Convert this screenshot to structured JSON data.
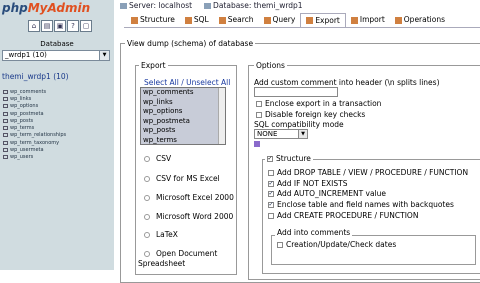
{
  "sidebar": {
    "logo_main": "php",
    "logo_accent": "MyAdmin",
    "icons": [
      "home-icon",
      "sql-icon",
      "query-icon",
      "docs-icon",
      "exit-icon"
    ],
    "db_label": "Database",
    "db_selected": "_wrdp1 (10)",
    "db_title": "themi_wrdp1 (10)",
    "tables": [
      "wp_comments",
      "wp_links",
      "wp_options",
      "wp_postmeta",
      "wp_posts",
      "wp_terms",
      "wp_term_relationships",
      "wp_term_taxonomy",
      "wp_usermeta",
      "wp_users"
    ]
  },
  "breadcrumb": {
    "server": "Server: localhost",
    "database": "Database: themi_wrdp1"
  },
  "tabs": [
    "Structure",
    "SQL",
    "Search",
    "Query",
    "Export",
    "Import",
    "Operations"
  ],
  "view_dump_title": "View dump (schema) of database",
  "export": {
    "legend": "Export",
    "select_all": "Select All / Unselect All",
    "tables": [
      "wp_comments",
      "wp_links",
      "wp_options",
      "wp_postmeta",
      "wp_posts",
      "wp_terms"
    ],
    "formats": [
      "CSV",
      "CSV for MS Excel",
      "Microsoft Excel 2000",
      "Microsoft Word 2000",
      "LaTeX",
      "Open Document",
      "Spreadsheet"
    ]
  },
  "options": {
    "legend": "Options",
    "comment_label": "Add custom comment into header (\\n splits lines)",
    "comment_value": "",
    "enclose_transaction": "Enclose export in a transaction",
    "disable_fk": "Disable foreign key checks",
    "compat_label": "SQL compatibility mode",
    "compat_value": "NONE",
    "structure": {
      "legend": "Structure",
      "drop_table": "Add DROP TABLE / VIEW / PROCEDURE / FUNCTION",
      "if_not_exists": "Add IF NOT EXISTS",
      "auto_increment": "Add AUTO_INCREMENT value",
      "backquotes": "Enclose table and field names with backquotes",
      "create_procedure": "Add CREATE PROCEDURE / FUNCTION",
      "comments_legend": "Add into comments",
      "creation_dates": "Creation/Update/Check dates"
    }
  }
}
